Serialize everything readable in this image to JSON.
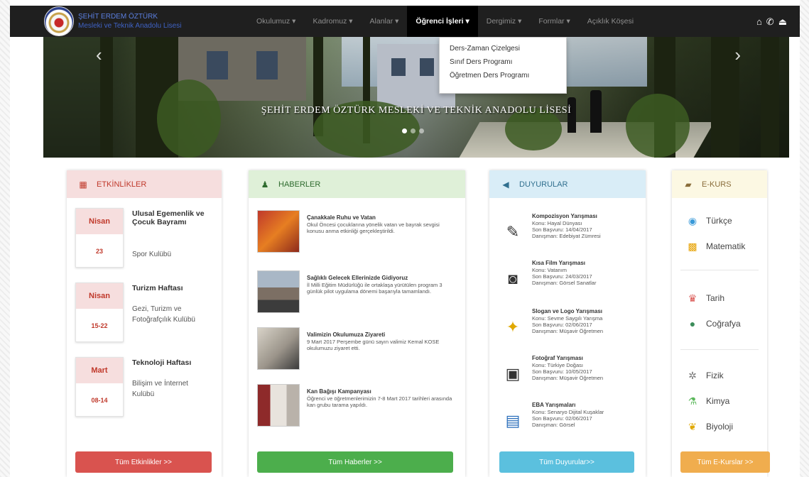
{
  "brand": {
    "line1": "ŞEHİT ERDEM ÖZTÜRK",
    "line2": "Mesleki ve Teknik Anadolu Lisesi"
  },
  "nav": {
    "items": [
      "Okulumuz",
      "Kadromuz",
      "Alanlar",
      "Öğrenci İşleri",
      "Dergimiz",
      "Formlar",
      "Açıklık Köşesi"
    ],
    "active_index": 3,
    "icons": [
      "home-icon",
      "phone-icon",
      "user-icon"
    ]
  },
  "dropdown": {
    "items": [
      "Ders-Zaman Çizelgesi",
      "Sınıf Ders Programı",
      "Öğretmen Ders Programı"
    ]
  },
  "slider": {
    "caption": "ŞEHİT ERDEM ÖZTÜRK MESLEKİ VE TEKNİK ANADOLU LİSESİ",
    "slide_count": 3,
    "active_slide": 0
  },
  "etkinlikler": {
    "title": "ETKİNLİKLER",
    "button": "Tüm Etkinlikler >>",
    "color": "#d9534f",
    "items": [
      {
        "month": "Nisan",
        "day": "23",
        "title": "Ulusal Egemenlik ve Çocuk Bayramı",
        "org": "Spor Kulübü"
      },
      {
        "month": "Nisan",
        "day": "15-22",
        "title": "Turizm Haftası",
        "org": "Gezi, Turizm ve Fotoğrafçılık Kulübü"
      },
      {
        "month": "Mart",
        "day": "08-14",
        "title": "Teknoloji Haftası",
        "org": "Bilişim ve İnternet Kulübü"
      }
    ]
  },
  "haberler": {
    "title": "HABERLER",
    "button": "Tüm Haberler >>",
    "color": "#4cae4c",
    "items": [
      {
        "title": "Çanakkale Ruhu ve Vatan",
        "text": "Okul Öncesi çocuklarına yönelik vatan ve bayrak sevgisi konusu anma etkinliği gerçekleştirildi."
      },
      {
        "title": "Sağlıklı Gelecek Ellerinizde Gidiyoruz",
        "text": "İl Milli Eğitim Müdürlüğü ile ortaklaşa yürütülen program 3 günlük pilot uygulama dönemi başarıyla tamamlandı."
      },
      {
        "title": "Valimizin Okulumuza Ziyareti",
        "text": "9 Mart 2017 Perşembe günü sayın valimiz Kemal KOSE okulumuzu ziyaret etti."
      },
      {
        "title": "Kan Bağışı Kampanyası",
        "text": "Öğrenci ve öğretmenlerimizin 7-8 Mart 2017 tarihleri arasında kan grubu tarama yapıldı."
      }
    ]
  },
  "duyurular": {
    "title": "DUYURULAR",
    "button": "Tüm Duyurular>>",
    "color": "#5bc0de",
    "items": [
      {
        "title": "Kompozisyon Yarışması",
        "lines": [
          "Konu: Hayal Dünyası",
          "Son Başvuru: 14/04/2017",
          "Danışman: Edebiyat Zümresi"
        ],
        "icon": "pen-icon"
      },
      {
        "title": "Kısa Film Yarışması",
        "lines": [
          "Konu: Vatanım",
          "Son Başvuru: 24/03/2017",
          "Danışman: Görsel Sanatlar"
        ],
        "icon": "camera-icon"
      },
      {
        "title": "Slogan ve Logo Yarışması",
        "lines": [
          "Konu: Sevme Saygılı Yarışma",
          "Son Başvuru: 02/06/2017",
          "Danışman: Müşavir Öğretmen"
        ],
        "icon": "trophy-icon"
      },
      {
        "title": "Fotoğraf Yarışması",
        "lines": [
          "Konu: Türkiye Doğası",
          "Son Başvuru: 10/05/2017",
          "Danışman: Müşavir Öğretmen"
        ],
        "icon": "photo-camera-icon"
      },
      {
        "title": "EBA Yarışmaları",
        "lines": [
          "Konu: Senaryo Dijital Kuşaklar",
          "Son Başvuru: 02/06/2017",
          "Danışman: Görsel"
        ],
        "icon": "computer-icon"
      }
    ]
  },
  "ekurs": {
    "title": "E-KURS",
    "button": "Tüm E-Kurslar >>",
    "color": "#f0ad4e",
    "courses": [
      {
        "name": "Türkçe",
        "icon": "globe-icon"
      },
      {
        "name": "Matematik",
        "icon": "abacus-icon"
      },
      {
        "name": "Tarih",
        "icon": "crown-icon"
      },
      {
        "name": "Coğrafya",
        "icon": "earth-icon"
      },
      {
        "name": "Fizik",
        "icon": "atom-icon"
      },
      {
        "name": "Kimya",
        "icon": "flask-icon"
      },
      {
        "name": "Biyoloji",
        "icon": "leaf-icon"
      }
    ]
  }
}
